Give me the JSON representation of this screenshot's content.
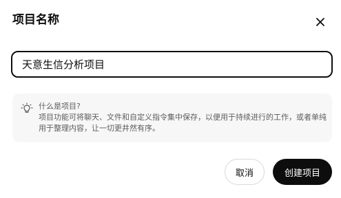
{
  "dialog": {
    "title": "项目名称",
    "close_icon": "close-icon"
  },
  "project_name": {
    "value": "天意生信分析项目"
  },
  "info": {
    "icon": "lightbulb-icon",
    "title": "什么是项目?",
    "body": "项目功能可将聊天、文件和自定义指令集中保存，以便用于持续进行的工作，或者单纯用于整理内容，让一切更井然有序。"
  },
  "buttons": {
    "cancel_label": "取消",
    "create_label": "创建项目"
  },
  "colors": {
    "primary": "#0d0d0d",
    "info_bg": "#f7f7f7",
    "muted_text": "#5d5d5d"
  }
}
